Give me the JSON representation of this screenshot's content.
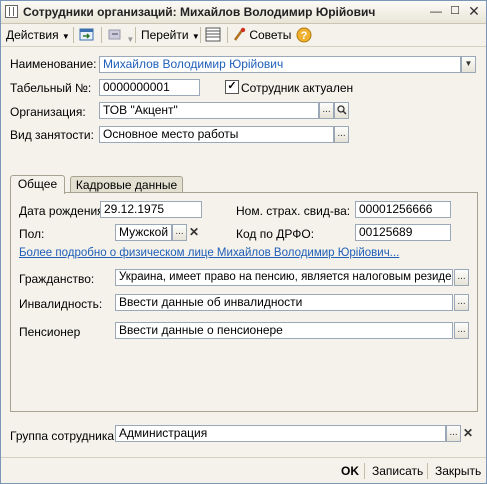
{
  "window": {
    "title": "Сотрудники организаций: Михайлов Володимир Юрійович"
  },
  "toolbar": {
    "actions_label": "Действия",
    "goto_label": "Перейти",
    "tips_label": "Советы"
  },
  "form": {
    "name_label": "Наименование:",
    "name_value": "Михайлов Володимир Юрійович",
    "tabnum_label": "Табельный №:",
    "tabnum_value": "0000000001",
    "active_label": "Сотрудник актуален",
    "active_checked": true,
    "org_label": "Организация:",
    "org_value": "ТОВ \"Акцент\"",
    "employment_label": "Вид занятости:",
    "employment_value": "Основное место работы",
    "group_label": "Группа сотрудника:",
    "group_value": "Администрация"
  },
  "tabs": [
    {
      "label": "Общее",
      "active": true
    },
    {
      "label": "Кадровые данные",
      "active": false
    }
  ],
  "general": {
    "birthdate_label": "Дата рождения:",
    "birthdate_value": "29.12.1975",
    "insurance_label": "Ном. страх. свид-ва:",
    "insurance_value": "00001256666",
    "gender_label": "Пол:",
    "gender_value": "Мужской",
    "drfo_label": "Код по ДРФО:",
    "drfo_value": "00125689",
    "person_link": "Более подробно о физическом лице Михайлов Володимир Юрійович...",
    "citizenship_label": "Гражданство:",
    "citizenship_value": "Украина, имеет право на пенсию, является налоговым резидент",
    "disability_label": "Инвалидность:",
    "disability_value": "Ввести данные об инвалидности",
    "pensioner_label": "Пенсионер",
    "pensioner_value": "Ввести данные о пенсионере"
  },
  "footer": {
    "ok_label": "OK",
    "save_label": "Записать",
    "close_label": "Закрыть"
  },
  "colors": {
    "link": "#1f5fb8",
    "window_bg": "#f4f2ea",
    "field_border": "#9aa8b8"
  },
  "icons": [
    "table-icon",
    "minimize-icon",
    "maximize-icon",
    "close-icon",
    "new-window-icon",
    "back-icon",
    "list-icon",
    "tips-icon",
    "help-icon",
    "dropdown-icon",
    "select-icon",
    "search-icon",
    "clear-icon",
    "checkbox-icon"
  ]
}
